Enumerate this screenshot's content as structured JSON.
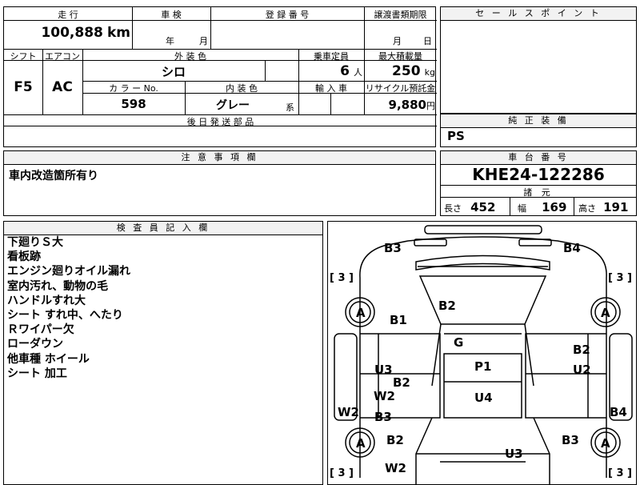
{
  "mileage": {
    "label": "走 行",
    "value": "100,888",
    "unit": "km"
  },
  "inspection": {
    "label": "車 検",
    "year_unit": "年",
    "month_unit": "月"
  },
  "registration": {
    "label": "登 録 番 号"
  },
  "transfer": {
    "label": "譲渡書類期限",
    "month_unit": "月",
    "day_unit": "日"
  },
  "shift": {
    "label": "シフト",
    "value": "F5"
  },
  "aircon": {
    "label": "エアコン",
    "value": "AC"
  },
  "exterior": {
    "label": "外 装 色",
    "value": "シロ"
  },
  "color_no": {
    "label": "カ ラ ー No.",
    "value": "598"
  },
  "interior": {
    "label": "内 装 色",
    "value": "グレー",
    "suffix": "系"
  },
  "capacity": {
    "label": "乗車定員",
    "value": "6",
    "unit": "人"
  },
  "payload": {
    "label": "最大積載量",
    "value": "250",
    "unit": "kg"
  },
  "import": {
    "label": "輸 入 車"
  },
  "recycle": {
    "label": "リサイクル預託金",
    "value": "9,880",
    "unit": "円"
  },
  "later_parts": {
    "label": "後 日 発 送 部 品"
  },
  "sales_point": {
    "label": "セ ー ル ス ポ イ ン ト"
  },
  "genuine": {
    "label": "純 正 装 備",
    "value": "PS"
  },
  "cautions": {
    "label": "注 意 事 項 欄",
    "value": "車内改造箇所有り"
  },
  "chassis": {
    "label": "車 台 番 号",
    "value": "KHE24-122286"
  },
  "specs": {
    "label": "諸 元",
    "length_label": "長さ",
    "length": "452",
    "width_label": "幅",
    "width": "169",
    "height_label": "高さ",
    "height": "191"
  },
  "inspector": {
    "label": "検 査 員 記 入 欄",
    "notes": [
      "下廻りＳ大",
      "看板跡",
      "エンジン廻りオイル漏れ",
      "室内汚れ、動物の毛",
      "ハンドルすれ大",
      "シート すれ中、へたり",
      "Ｒワイパー欠",
      "ローダウン",
      "他車種 ホイール",
      "シート 加工"
    ]
  },
  "diagram": {
    "tire_marks": [
      "[ 3 ]",
      "[ 3 ]",
      "[ 3 ]",
      "[ 3 ]"
    ],
    "tire_grades": [
      "A",
      "A",
      "A",
      "A"
    ],
    "damage_codes": [
      "B3",
      "B4",
      "B2",
      "B1",
      "G",
      "P1",
      "B2",
      "U3",
      "U2",
      "B2",
      "W2",
      "U4",
      "W2",
      "B3",
      "B4",
      "B2",
      "B3",
      "U3",
      "W2"
    ]
  }
}
